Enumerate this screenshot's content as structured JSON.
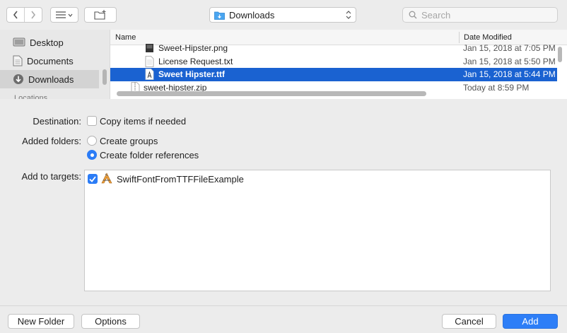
{
  "toolbar": {
    "location": "Downloads",
    "search_placeholder": "Search"
  },
  "sidebar": {
    "items": [
      {
        "label": "Desktop"
      },
      {
        "label": "Documents"
      },
      {
        "label": "Downloads"
      }
    ],
    "clipped_section": "Locations"
  },
  "file_list": {
    "columns": {
      "name": "Name",
      "date": "Date Modified"
    },
    "rows": [
      {
        "name": "Sweet-Hipster.png",
        "date": "Jan 15, 2018 at 7:05 PM",
        "icon": "png-file-icon"
      },
      {
        "name": "License Request.txt",
        "date": "Jan 15, 2018 at 5:50 PM",
        "icon": "text-file-icon"
      },
      {
        "name": "Sweet Hipster.ttf",
        "date": "Jan 15, 2018 at 5:44 PM",
        "icon": "font-file-icon",
        "selected": true
      },
      {
        "name": "sweet-hipster.zip",
        "date": "Today at 8:59 PM",
        "icon": "zip-file-icon"
      }
    ]
  },
  "options": {
    "destination_label": "Destination:",
    "copy_items_label": "Copy items if needed",
    "copy_items_checked": false,
    "added_folders_label": "Added folders:",
    "create_groups_label": "Create groups",
    "create_folder_refs_label": "Create folder references",
    "selected_folder_option": "Create folder references",
    "add_to_targets_label": "Add to targets:",
    "targets": [
      {
        "name": "SwiftFontFromTTFFileExample",
        "checked": true
      }
    ]
  },
  "buttons": {
    "new_folder": "New Folder",
    "options": "Options",
    "cancel": "Cancel",
    "add": "Add"
  },
  "colors": {
    "accent": "#2d7ef7",
    "selection": "#1a62d1"
  }
}
